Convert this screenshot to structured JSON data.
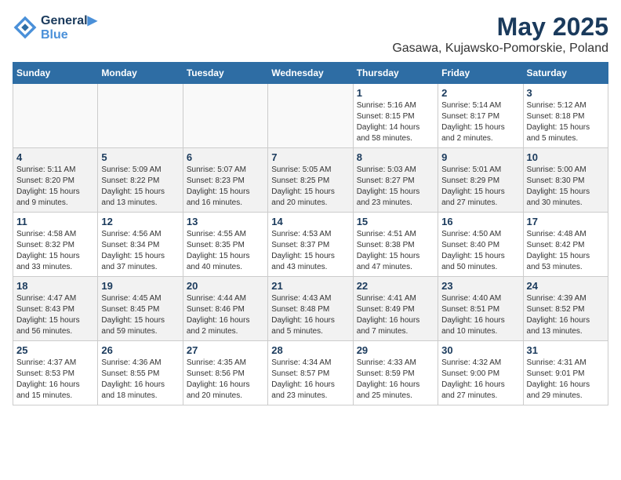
{
  "header": {
    "logo_line1": "General",
    "logo_line2": "Blue",
    "month": "May 2025",
    "location": "Gasawa, Kujawsko-Pomorskie, Poland"
  },
  "weekdays": [
    "Sunday",
    "Monday",
    "Tuesday",
    "Wednesday",
    "Thursday",
    "Friday",
    "Saturday"
  ],
  "weeks": [
    [
      {
        "day": "",
        "info": ""
      },
      {
        "day": "",
        "info": ""
      },
      {
        "day": "",
        "info": ""
      },
      {
        "day": "",
        "info": ""
      },
      {
        "day": "1",
        "info": "Sunrise: 5:16 AM\nSunset: 8:15 PM\nDaylight: 14 hours\nand 58 minutes."
      },
      {
        "day": "2",
        "info": "Sunrise: 5:14 AM\nSunset: 8:17 PM\nDaylight: 15 hours\nand 2 minutes."
      },
      {
        "day": "3",
        "info": "Sunrise: 5:12 AM\nSunset: 8:18 PM\nDaylight: 15 hours\nand 5 minutes."
      }
    ],
    [
      {
        "day": "4",
        "info": "Sunrise: 5:11 AM\nSunset: 8:20 PM\nDaylight: 15 hours\nand 9 minutes."
      },
      {
        "day": "5",
        "info": "Sunrise: 5:09 AM\nSunset: 8:22 PM\nDaylight: 15 hours\nand 13 minutes."
      },
      {
        "day": "6",
        "info": "Sunrise: 5:07 AM\nSunset: 8:23 PM\nDaylight: 15 hours\nand 16 minutes."
      },
      {
        "day": "7",
        "info": "Sunrise: 5:05 AM\nSunset: 8:25 PM\nDaylight: 15 hours\nand 20 minutes."
      },
      {
        "day": "8",
        "info": "Sunrise: 5:03 AM\nSunset: 8:27 PM\nDaylight: 15 hours\nand 23 minutes."
      },
      {
        "day": "9",
        "info": "Sunrise: 5:01 AM\nSunset: 8:29 PM\nDaylight: 15 hours\nand 27 minutes."
      },
      {
        "day": "10",
        "info": "Sunrise: 5:00 AM\nSunset: 8:30 PM\nDaylight: 15 hours\nand 30 minutes."
      }
    ],
    [
      {
        "day": "11",
        "info": "Sunrise: 4:58 AM\nSunset: 8:32 PM\nDaylight: 15 hours\nand 33 minutes."
      },
      {
        "day": "12",
        "info": "Sunrise: 4:56 AM\nSunset: 8:34 PM\nDaylight: 15 hours\nand 37 minutes."
      },
      {
        "day": "13",
        "info": "Sunrise: 4:55 AM\nSunset: 8:35 PM\nDaylight: 15 hours\nand 40 minutes."
      },
      {
        "day": "14",
        "info": "Sunrise: 4:53 AM\nSunset: 8:37 PM\nDaylight: 15 hours\nand 43 minutes."
      },
      {
        "day": "15",
        "info": "Sunrise: 4:51 AM\nSunset: 8:38 PM\nDaylight: 15 hours\nand 47 minutes."
      },
      {
        "day": "16",
        "info": "Sunrise: 4:50 AM\nSunset: 8:40 PM\nDaylight: 15 hours\nand 50 minutes."
      },
      {
        "day": "17",
        "info": "Sunrise: 4:48 AM\nSunset: 8:42 PM\nDaylight: 15 hours\nand 53 minutes."
      }
    ],
    [
      {
        "day": "18",
        "info": "Sunrise: 4:47 AM\nSunset: 8:43 PM\nDaylight: 15 hours\nand 56 minutes."
      },
      {
        "day": "19",
        "info": "Sunrise: 4:45 AM\nSunset: 8:45 PM\nDaylight: 15 hours\nand 59 minutes."
      },
      {
        "day": "20",
        "info": "Sunrise: 4:44 AM\nSunset: 8:46 PM\nDaylight: 16 hours\nand 2 minutes."
      },
      {
        "day": "21",
        "info": "Sunrise: 4:43 AM\nSunset: 8:48 PM\nDaylight: 16 hours\nand 5 minutes."
      },
      {
        "day": "22",
        "info": "Sunrise: 4:41 AM\nSunset: 8:49 PM\nDaylight: 16 hours\nand 7 minutes."
      },
      {
        "day": "23",
        "info": "Sunrise: 4:40 AM\nSunset: 8:51 PM\nDaylight: 16 hours\nand 10 minutes."
      },
      {
        "day": "24",
        "info": "Sunrise: 4:39 AM\nSunset: 8:52 PM\nDaylight: 16 hours\nand 13 minutes."
      }
    ],
    [
      {
        "day": "25",
        "info": "Sunrise: 4:37 AM\nSunset: 8:53 PM\nDaylight: 16 hours\nand 15 minutes."
      },
      {
        "day": "26",
        "info": "Sunrise: 4:36 AM\nSunset: 8:55 PM\nDaylight: 16 hours\nand 18 minutes."
      },
      {
        "day": "27",
        "info": "Sunrise: 4:35 AM\nSunset: 8:56 PM\nDaylight: 16 hours\nand 20 minutes."
      },
      {
        "day": "28",
        "info": "Sunrise: 4:34 AM\nSunset: 8:57 PM\nDaylight: 16 hours\nand 23 minutes."
      },
      {
        "day": "29",
        "info": "Sunrise: 4:33 AM\nSunset: 8:59 PM\nDaylight: 16 hours\nand 25 minutes."
      },
      {
        "day": "30",
        "info": "Sunrise: 4:32 AM\nSunset: 9:00 PM\nDaylight: 16 hours\nand 27 minutes."
      },
      {
        "day": "31",
        "info": "Sunrise: 4:31 AM\nSunset: 9:01 PM\nDaylight: 16 hours\nand 29 minutes."
      }
    ]
  ]
}
